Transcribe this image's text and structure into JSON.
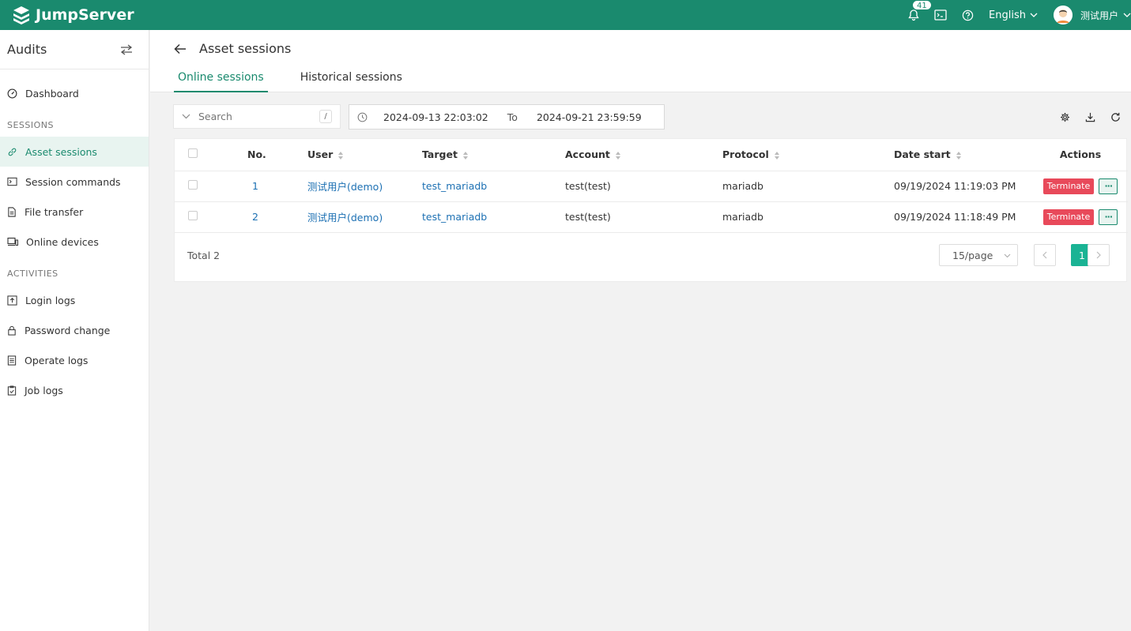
{
  "header": {
    "brand": "JumpServer",
    "notifications_count": "41",
    "language": "English",
    "user_name": "测试用户"
  },
  "sidebar": {
    "title": "Audits",
    "dashboard": "Dashboard",
    "groups": [
      {
        "label": "SESSIONS",
        "items": [
          "Asset sessions",
          "Session commands",
          "File transfer",
          "Online devices"
        ]
      },
      {
        "label": "ACTIVITIES",
        "items": [
          "Login logs",
          "Password change",
          "Operate logs",
          "Job logs"
        ]
      }
    ]
  },
  "page": {
    "title": "Asset sessions",
    "tabs": [
      "Online sessions",
      "Historical sessions"
    ]
  },
  "toolbar": {
    "search_placeholder": "Search",
    "shortcut": "/",
    "date_from": "2024-09-13 22:03:02",
    "date_to_label": "To",
    "date_to": "2024-09-21 23:59:59"
  },
  "table": {
    "columns": [
      "No.",
      "User",
      "Target",
      "Account",
      "Protocol",
      "Date start",
      "Actions"
    ],
    "rows": [
      {
        "no": "1",
        "user": "测试用户(demo)",
        "target": "test_mariadb",
        "account": "test(test)",
        "protocol": "mariadb",
        "date_start": "09/19/2024 11:19:03 PM",
        "action": "Terminate"
      },
      {
        "no": "2",
        "user": "测试用户(demo)",
        "target": "test_mariadb",
        "account": "test(test)",
        "protocol": "mariadb",
        "date_start": "09/19/2024 11:18:49 PM",
        "action": "Terminate"
      }
    ],
    "more_label": "···"
  },
  "pagination": {
    "total": "Total 2",
    "page_size": "15/page",
    "current_page": "1"
  },
  "colors": {
    "primary": "#1a8a6e",
    "link": "#1c70b3",
    "danger": "#e8495a",
    "active_page": "#1ab394"
  }
}
